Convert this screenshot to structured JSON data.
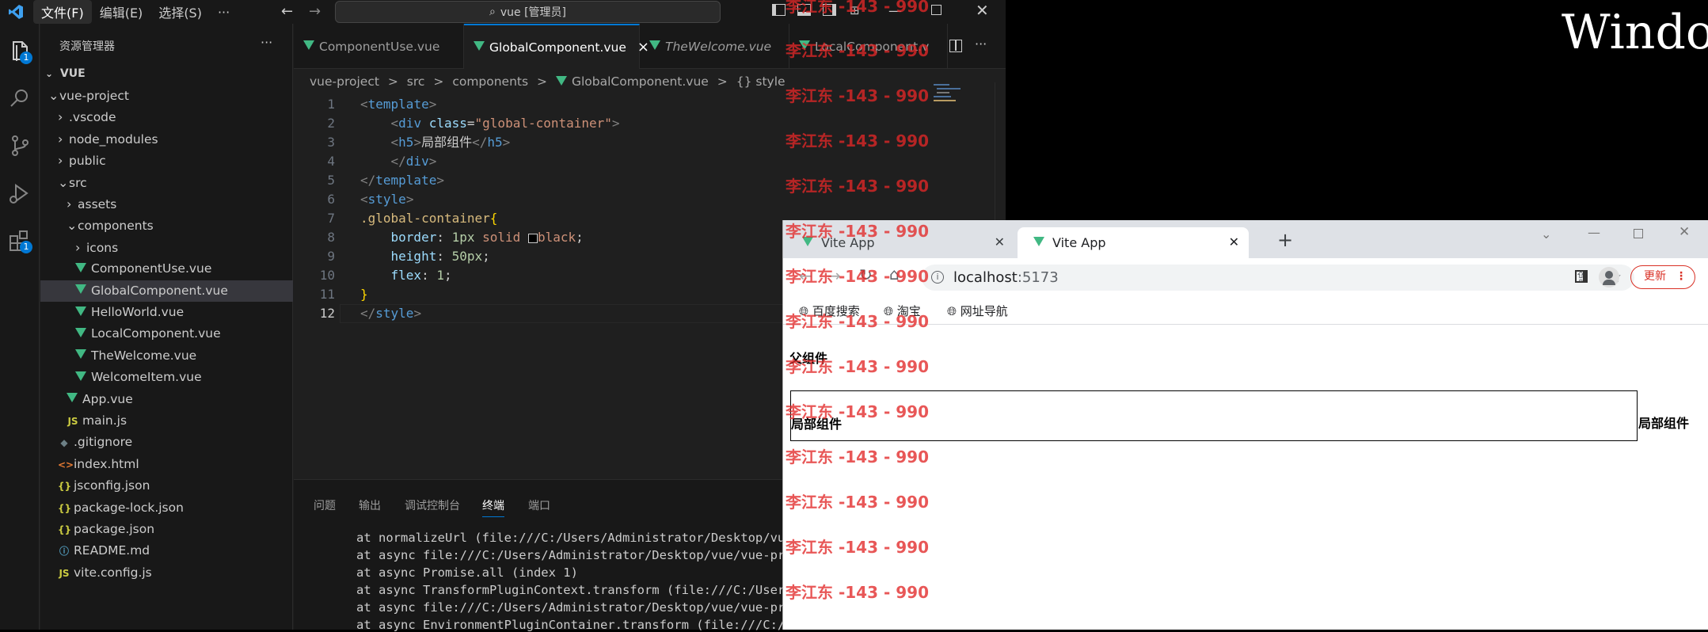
{
  "vscode": {
    "menu": [
      "文件(F)",
      "编辑(E)",
      "选择(S)",
      "···"
    ],
    "command_center": "vue [管理员]",
    "activity_badges": {
      "explorer": "1",
      "extensions": "1"
    },
    "sidebar": {
      "title": "资源管理器",
      "more": "···",
      "root": "VUE",
      "items": [
        {
          "label": "vue-project",
          "kind": "folder-open"
        },
        {
          "label": ".vscode",
          "kind": "folder"
        },
        {
          "label": "node_modules",
          "kind": "folder"
        },
        {
          "label": "public",
          "kind": "folder"
        },
        {
          "label": "src",
          "kind": "folder-open"
        },
        {
          "label": "assets",
          "kind": "folder"
        },
        {
          "label": "components",
          "kind": "folder-open"
        },
        {
          "label": "icons",
          "kind": "folder"
        },
        {
          "label": "ComponentUse.vue",
          "kind": "vue"
        },
        {
          "label": "GlobalComponent.vue",
          "kind": "vue",
          "selected": true
        },
        {
          "label": "HelloWorld.vue",
          "kind": "vue"
        },
        {
          "label": "LocalComponent.vue",
          "kind": "vue"
        },
        {
          "label": "TheWelcome.vue",
          "kind": "vue"
        },
        {
          "label": "WelcomeItem.vue",
          "kind": "vue"
        },
        {
          "label": "App.vue",
          "kind": "vue"
        },
        {
          "label": "main.js",
          "kind": "js"
        },
        {
          "label": ".gitignore",
          "kind": "git"
        },
        {
          "label": "index.html",
          "kind": "html"
        },
        {
          "label": "jsconfig.json",
          "kind": "json"
        },
        {
          "label": "package-lock.json",
          "kind": "json"
        },
        {
          "label": "package.json",
          "kind": "json"
        },
        {
          "label": "README.md",
          "kind": "md"
        },
        {
          "label": "vite.config.js",
          "kind": "js"
        }
      ]
    },
    "tabs": [
      {
        "label": "ComponentUse.vue"
      },
      {
        "label": "GlobalComponent.vue",
        "active": true,
        "close": "×"
      },
      {
        "label": "TheWelcome.vue",
        "italic": true
      },
      {
        "label": "LocalComponent.v"
      }
    ],
    "breadcrumb": [
      "vue-project",
      "src",
      "components",
      "GlobalComponent.vue",
      "{} style"
    ],
    "breadcrumb_sep": ">",
    "code_lines": [
      "1",
      "2",
      "3",
      "4",
      "5",
      "6",
      "7",
      "8",
      "9",
      "10",
      "11",
      "12"
    ],
    "code": {
      "l1_tag": "template",
      "l2_tag": "div",
      "l2_attr": "class",
      "l2_val": "\"global-container\"",
      "l3_tag": "h5",
      "l3_text": "局部组件",
      "l4_tag": "div",
      "l5_tag": "template",
      "l6_tag": "style",
      "l7_sel": ".global-container",
      "l8_prop": "border",
      "l8_val_a": "1px",
      "l8_val_b": "solid",
      "l8_val_c": "black",
      "l9_prop": "height",
      "l9_val": "50px",
      "l10_prop": "flex",
      "l10_val": "1",
      "l12_tag": "style"
    },
    "panel": {
      "tabs": [
        "问题",
        "输出",
        "调试控制台",
        "终端",
        "端口"
      ],
      "active_tab": "终端",
      "terminal": [
        "at normalizeUrl (file:///C:/Users/Administrator/Desktop/vue/",
        "at async file:///C:/Users/Administrator/Desktop/vue/vue-proj",
        "at async Promise.all (index 1)",
        "at async TransformPluginContext.transform (file:///C:/Users/",
        "at async file:///C:/Users/Administrator/Desktop/vue/vue-proj",
        "at async EnvironmentPluginContainer.transform (file:///C:/Us"
      ]
    }
  },
  "desktop_text": "Windo",
  "chrome": {
    "tabs": [
      {
        "label": "Vite App"
      },
      {
        "label": "Vite App",
        "active": true
      }
    ],
    "new_tab": "+",
    "url_host": "localhost",
    "url_port": ":5173",
    "update_button": "更新",
    "bookmarks": [
      "百度搜索",
      "淘宝",
      "网址导航"
    ],
    "page": {
      "parent_label": "父组件",
      "box_label": "局部组件",
      "right_label": "局部组件"
    }
  },
  "watermark": "李江东 -143 - 990",
  "colors": {
    "accent": "#0078d4",
    "vue_green": "#41b883",
    "watermark": "#e22828"
  }
}
